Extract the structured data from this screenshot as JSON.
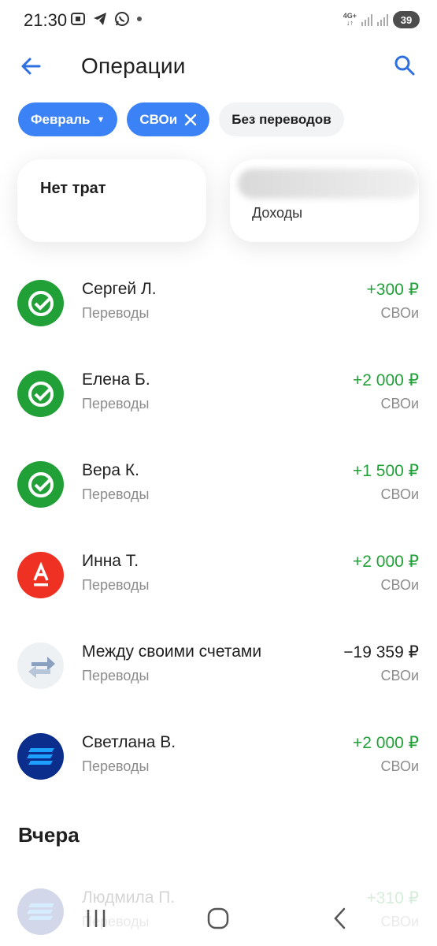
{
  "status_bar": {
    "time": "21:30",
    "network": "4G+",
    "battery": "39"
  },
  "header": {
    "title": "Операции"
  },
  "filters": [
    {
      "label": "Февраль",
      "style": "blue",
      "trailing": "▼"
    },
    {
      "label": "СВОи",
      "style": "blue",
      "trailing": "close"
    },
    {
      "label": "Без переводов",
      "style": "grey"
    }
  ],
  "summary": {
    "expenses_label": "Нет трат",
    "income_label": "Доходы"
  },
  "transactions": [
    {
      "name": "Сергей Л.",
      "category": "Переводы",
      "amount": "+300 ₽",
      "account": "СВОи",
      "icon": "sber-icon",
      "type": "pos"
    },
    {
      "name": "Елена Б.",
      "category": "Переводы",
      "amount": "+2 000 ₽",
      "account": "СВОи",
      "icon": "sber-icon",
      "type": "pos"
    },
    {
      "name": "Вера К.",
      "category": "Переводы",
      "amount": "+1 500 ₽",
      "account": "СВОи",
      "icon": "sber-icon",
      "type": "pos"
    },
    {
      "name": "Инна Т.",
      "category": "Переводы",
      "amount": "+2 000 ₽",
      "account": "СВОи",
      "icon": "alfa-icon",
      "type": "pos"
    },
    {
      "name": "Между своими счетами",
      "category": "Переводы",
      "amount": "−19 359 ₽",
      "account": "СВОи",
      "icon": "transfer-arrows-icon",
      "type": "neg"
    },
    {
      "name": "Светлана В.",
      "category": "Переводы",
      "amount": "+2 000 ₽",
      "account": "СВОи",
      "icon": "vtb-icon",
      "type": "pos"
    }
  ],
  "section_yesterday": "Вчера",
  "yesterday_transactions": [
    {
      "name": "Людмила П.",
      "category": "Переводы",
      "amount": "+310 ₽",
      "account": "СВОи",
      "icon": "vtb-icon",
      "type": "pos"
    }
  ],
  "colors": {
    "accent": "#3b82f6",
    "positive": "#21a038",
    "sber": "#21a038",
    "alfa": "#ef3124",
    "vtb": "#0b2d8c"
  }
}
